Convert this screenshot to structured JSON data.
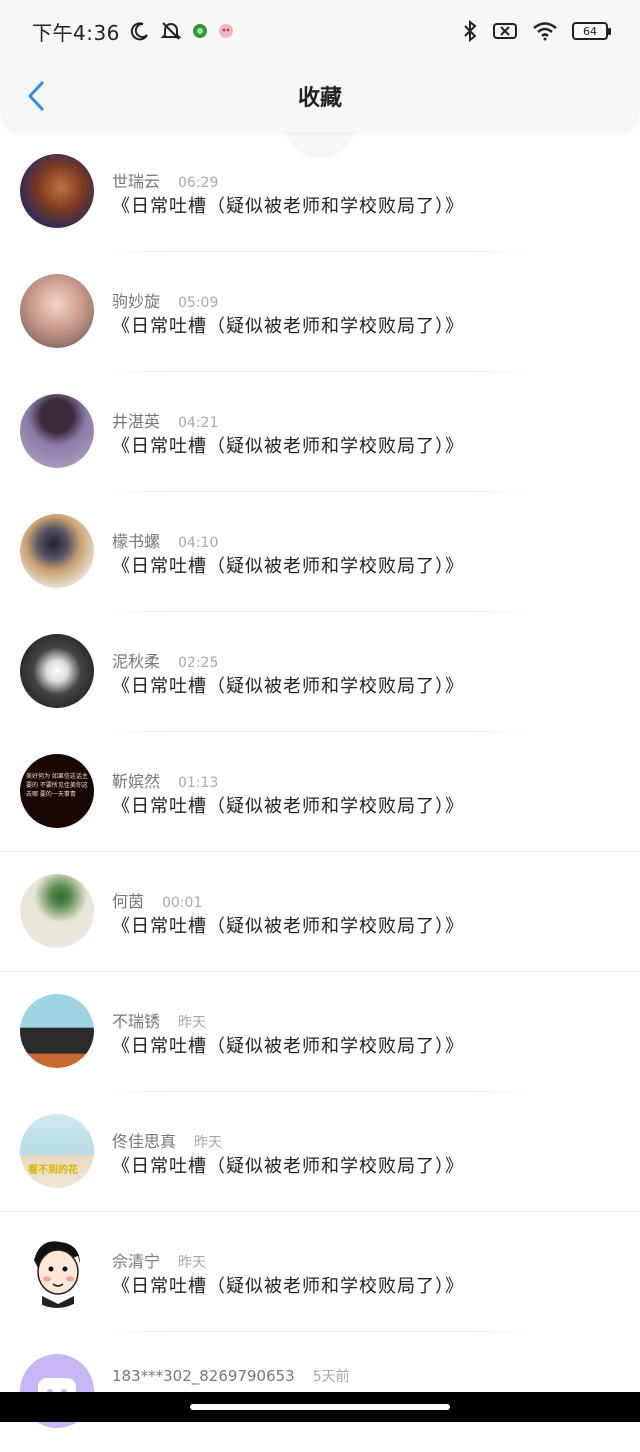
{
  "status_bar": {
    "time": "下午4:36",
    "left_icons": [
      "moon-icon",
      "bell-off-icon",
      "green-app-icon",
      "pink-app-icon"
    ],
    "right_icons": [
      "bluetooth-icon",
      "sim-none-icon",
      "wifi-icon"
    ],
    "battery_level": "64"
  },
  "header": {
    "title": "收藏",
    "back_icon": "chevron-left-icon",
    "accent_color": "#2d8cf0"
  },
  "items": [
    {
      "name": "世瑞云",
      "time": "06:29",
      "title": "《日常吐槽（疑似被老师和学校败局了）》"
    },
    {
      "name": "驹妙旋",
      "time": "05:09",
      "title": "《日常吐槽（疑似被老师和学校败局了）》"
    },
    {
      "name": "井湛英",
      "time": "04:21",
      "title": "《日常吐槽（疑似被老师和学校败局了）》"
    },
    {
      "name": "檬书螺",
      "time": "04:10",
      "title": "《日常吐槽（疑似被老师和学校败局了）》"
    },
    {
      "name": "泥秋柔",
      "time": "02:25",
      "title": "《日常吐槽（疑似被老师和学校败局了）》"
    },
    {
      "name": "靳嫔然",
      "time": "01:13",
      "title": "《日常吐槽（疑似被老师和学校败局了）》",
      "avatar_text": "美好何为 如果信这话主要的 不要所见佳美你这去哪 要的一天事青"
    },
    {
      "name": "何茵",
      "time": "00:01",
      "title": "《日常吐槽（疑似被老师和学校败局了）》"
    },
    {
      "name": "不瑞锈",
      "time": "昨天",
      "title": "《日常吐槽（疑似被老师和学校败局了）》"
    },
    {
      "name": "佟佳思真",
      "time": "昨天",
      "title": "《日常吐槽（疑似被老师和学校败局了）》",
      "avatar_text": "看不到的花"
    },
    {
      "name": "佘清宁",
      "time": "昨天",
      "title": "《日常吐槽（疑似被老师和学校败局了）》"
    }
  ],
  "partial_item": {
    "name": "183***302_8269790653",
    "time": "5天前"
  }
}
